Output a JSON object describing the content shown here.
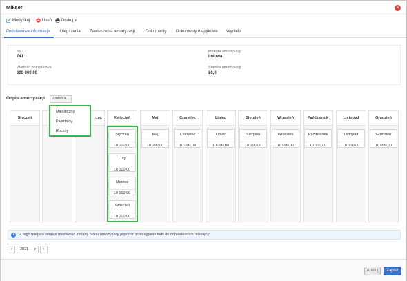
{
  "window": {
    "title": "Mikser"
  },
  "toolbar": {
    "modify_label": "Modyfikuj",
    "delete_label": "Usuń",
    "print_label": "Drukuj"
  },
  "tabs": [
    {
      "label": "Podstawowe informacje"
    },
    {
      "label": "Ulepszenia"
    },
    {
      "label": "Zawieszenia amortyzacji"
    },
    {
      "label": "Dokumenty"
    },
    {
      "label": "Dokumenty majątkowe"
    },
    {
      "label": "Wydatki"
    }
  ],
  "info": {
    "kst_label": "KST",
    "kst_value": "741",
    "method_label": "Metoda amortyzacji",
    "method_value": "liniowa",
    "initial_label": "Wartość początkowa",
    "initial_value": "600 000,00",
    "rate_label": "Stawka amortyzacji",
    "rate_value": "20,0"
  },
  "depreciation": {
    "label": "Odpis amortyzacji",
    "change_label": "Zmień",
    "dropdown_options": [
      "Miesięczny",
      "Kwartalny",
      "Roczny"
    ]
  },
  "months": [
    "Styczeń",
    "Luty",
    "Marzec",
    "Kwiecień",
    "Maj",
    "Czerwiec",
    "Lipiec",
    "Sierpień",
    "Wrzesień",
    "Październik",
    "Listopad",
    "Grudzień"
  ],
  "month_header_partial": "rzec",
  "cards": {
    "april": [
      {
        "month": "Styczeń",
        "amount": "10 000,00"
      },
      {
        "month": "Luty",
        "amount": "10 000,00"
      },
      {
        "month": "Marzec",
        "amount": "10 000,00"
      },
      {
        "month": "Kwiecień",
        "amount": "10 000,00"
      }
    ],
    "single": [
      {
        "month": "Maj",
        "amount": "10 000,00"
      },
      {
        "month": "Czerwiec",
        "amount": "10 000,00"
      },
      {
        "month": "Lipiec",
        "amount": "10 000,00"
      },
      {
        "month": "Sierpień",
        "amount": "10 000,00"
      },
      {
        "month": "Wrzesień",
        "amount": "10 000,00"
      },
      {
        "month": "Październik",
        "amount": "10 000,00"
      },
      {
        "month": "Listopad",
        "amount": "10 000,00"
      },
      {
        "month": "Grudzień",
        "amount": "10 000,00"
      }
    ]
  },
  "notice": {
    "text": "Z tego miejsca istnieje możliwość zmiany planu amortyzacji poprzez przeciąganie kafli do odpowiednich miesięcy."
  },
  "year": {
    "prev": "‹",
    "value": "2021",
    "caret": "▾",
    "next": "›"
  },
  "footer": {
    "cancel_label": "Anuluj",
    "save_label": "Zapisz"
  },
  "colors": {
    "accent": "#3a6fc9",
    "highlight": "#3bb54a",
    "danger": "#e04646"
  }
}
